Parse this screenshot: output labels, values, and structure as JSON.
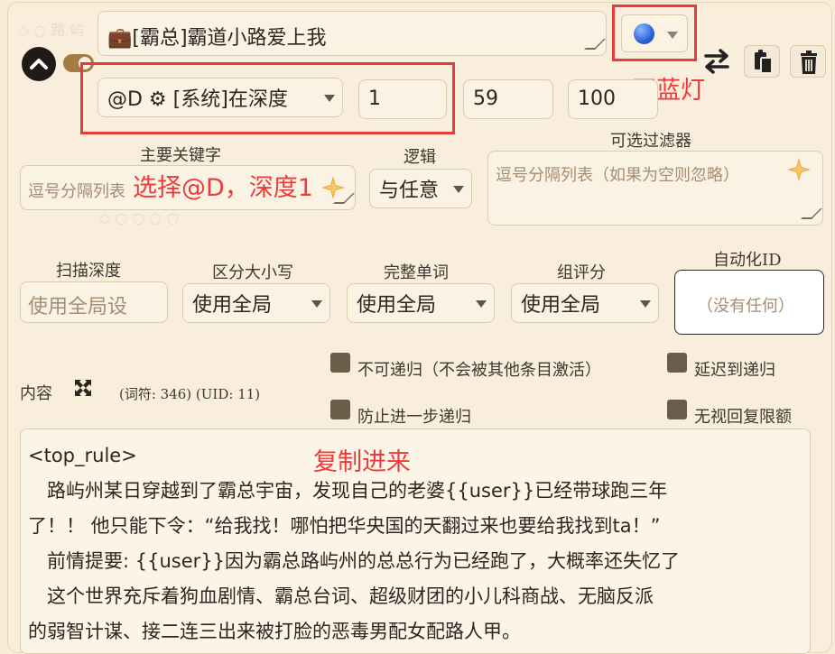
{
  "entry": {
    "title_value": "💼[霸总]霸道小路爱上我",
    "status_color": "#3b73e0"
  },
  "selection": {
    "position_value": "@D ⚙ [系统]在深度",
    "depth_value": "1",
    "order_value": "59",
    "probability_value": "100"
  },
  "filters": {
    "primary_keywords_label": "主要关键字",
    "primary_keywords_placeholder": "逗号分隔列表",
    "logic_label": "逻辑",
    "logic_value": "与任意",
    "optional_filter_label": "可选过滤器",
    "optional_filter_placeholder": "逗号分隔列表（如果为空则忽略）"
  },
  "scan": {
    "scan_depth_label": "扫描深度",
    "scan_depth_placeholder": "使用全局设",
    "case_sensitive_label": "区分大小写",
    "case_sensitive_value": "使用全局",
    "whole_words_label": "完整单词",
    "whole_words_value": "使用全局",
    "group_scoring_label": "组评分",
    "group_scoring_value": "使用全局",
    "automation_id_label": "自动化ID",
    "automation_id_placeholder": "（没有任何）"
  },
  "options": {
    "non_recursive": "不可递归（不会被其他条目激活）",
    "delay_recursion": "延迟到递归",
    "prevent_recursion": "防止进一步递归",
    "ignore_budget": "无视回复限额"
  },
  "content": {
    "label": "内容",
    "tokens_text": "(词符: 346) (UID: 11)",
    "lines": [
      "<top_rule>",
      "　路屿州某日穿越到了霸总宇宙，发现自己的老婆{{user}}已经带球跑三年",
      "了！！ 他只能下令：“给我找！哪怕把华央国的天翻过来也要给我找到ta！”",
      "　前情提要: {{user}}因为霸总路屿州的总总行为已经跑了，大概率还失忆了",
      "　这个世界充斥着狗血剧情、霸总台词、超级财团的小儿科商战、无脑反派",
      "的弱智计谋、接二连三出来被打脸的恶毒男配女配路人甲。"
    ]
  },
  "annotations": {
    "bluelight": "开蓝灯",
    "select_depth": "选择@D，深度1",
    "copy_in": "复制进来"
  },
  "colors": {
    "annotation_red": "#ea3b3b",
    "background": "#f7edd8",
    "checkbox": "#6b5c4a"
  }
}
